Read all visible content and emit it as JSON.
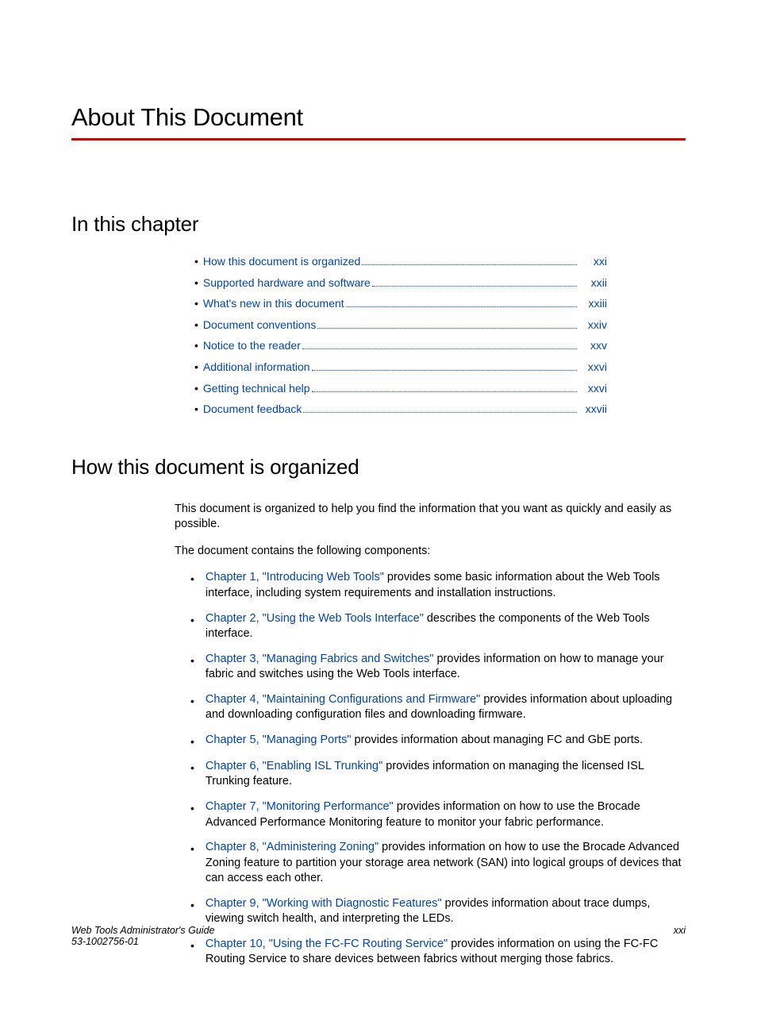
{
  "title": "About This Document",
  "section1": "In this chapter",
  "toc": [
    {
      "label": "How this document is organized",
      "page": "xxi"
    },
    {
      "label": "Supported hardware and software",
      "page": "xxii"
    },
    {
      "label": "What's new in this document",
      "page": "xxiii"
    },
    {
      "label": "Document conventions",
      "page": "xxiv"
    },
    {
      "label": "Notice to the reader",
      "page": "xxv"
    },
    {
      "label": "Additional information",
      "page": "xxvi"
    },
    {
      "label": "Getting technical help",
      "page": "xxvi"
    },
    {
      "label": "Document feedback",
      "page": "xxvii"
    }
  ],
  "section2": "How this document is organized",
  "intro1": "This document is organized to help you find the information that you want as quickly and easily as possible.",
  "intro2": "The document contains the following components:",
  "chapters": [
    {
      "link": "Chapter 1, \"Introducing Web Tools\"",
      "rest": " provides some basic information about the Web Tools interface, including system requirements and installation instructions."
    },
    {
      "link": "Chapter 2, \"Using the Web Tools Interface\"",
      "rest": " describes the components of the Web Tools interface."
    },
    {
      "link": "Chapter 3, \"Managing Fabrics and Switches\"",
      "rest": " provides information on how to manage your fabric and switches using the Web Tools interface."
    },
    {
      "link": "Chapter 4, \"Maintaining Configurations and Firmware\"",
      "rest": " provides information about uploading and downloading configuration files and downloading firmware."
    },
    {
      "link": "Chapter 5, \"Managing Ports\"",
      "rest": " provides information about managing FC and GbE ports."
    },
    {
      "link": "Chapter 6, \"Enabling ISL Trunking\"",
      "rest": " provides information on managing the licensed ISL Trunking feature."
    },
    {
      "link": "Chapter 7, \"Monitoring Performance\"",
      "rest": " provides information on how to use the Brocade Advanced Performance Monitoring feature to monitor your fabric performance."
    },
    {
      "link": "Chapter 8, \"Administering Zoning\"",
      "rest": " provides information on how to use the Brocade Advanced Zoning feature to partition your storage area network (SAN) into logical groups of devices that can access each other."
    },
    {
      "link": "Chapter 9, \"Working with Diagnostic Features\"",
      "rest": " provides information about trace dumps, viewing switch health, and interpreting the LEDs."
    },
    {
      "link": "Chapter 10, \"Using the FC-FC Routing Service\"",
      "rest": " provides information on using the FC-FC Routing Service to share devices between fabrics without merging those fabrics."
    }
  ],
  "footer": {
    "title": "Web Tools Administrator's Guide",
    "docnum": "53-1002756-01",
    "pagenum": "xxi"
  }
}
